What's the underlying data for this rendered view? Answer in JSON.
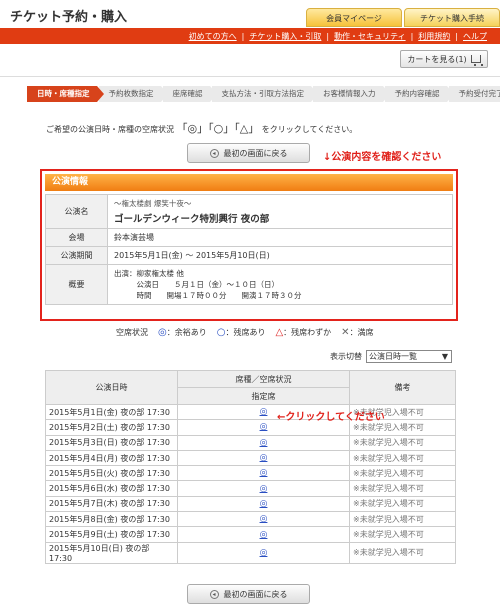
{
  "header": {
    "site_title": "チケット予約・購入",
    "tab_mypage": "会員マイページ",
    "tab_purchase": "チケット購入手続"
  },
  "nav": {
    "items": [
      "初めての方へ",
      "チケット購入・引取",
      "動作・セキュリティ",
      "利用規約",
      "ヘルプ"
    ]
  },
  "cart": {
    "label": "カートを見る(1)"
  },
  "steps": [
    "日時・席種指定",
    "予約枚数指定",
    "座席確認",
    "支払方法・引取方法指定",
    "お客様情報入力",
    "予約内容確認",
    "予約受付完了"
  ],
  "instruction": {
    "prefix": "ご希望の公演日時・席種の空席状況",
    "b1": "「",
    "s1": "◎",
    "b2": "」「",
    "s2": "○",
    "b3": "」「",
    "s3": "△",
    "b4": "」",
    "suffix": "をクリックしてください。"
  },
  "back_button": {
    "label": "最初の画面に戻る"
  },
  "red_note": "↓公演内容を確認ください",
  "performance": {
    "header": "公演情報",
    "labels": {
      "name": "公演名",
      "venue": "会場",
      "period": "公演期間",
      "overview": "概要"
    },
    "subtitle": "～権太楼劇 爆笑十夜～",
    "name": "ゴールデンウィーク特別興行 夜の部",
    "venue": "鈴本演芸場",
    "period": "2015年5月1日(金) ～ 2015年5月10日(日)",
    "overview": [
      "出演：柳家権太楼 他",
      "　　　公演日　　５月１日（金）～１０日（日）",
      "　　　時間　　開場１７時００分　　開演１７時３０分"
    ]
  },
  "legend": {
    "label": "空席状況",
    "items": [
      {
        "symbol": "◎",
        "text": "：余裕あり"
      },
      {
        "symbol": "○",
        "text": "：残席あり"
      },
      {
        "symbol": "△",
        "text": "：残席わずか"
      },
      {
        "symbol": "✕",
        "text": "：満席"
      }
    ]
  },
  "display_switch": {
    "label": "表示切替",
    "value": "公演日時一覧",
    "arrow": "▼"
  },
  "table": {
    "col_datetime": "公演日時",
    "col_status": "席種／空席状況",
    "col_seat": "指定席",
    "col_note": "備考",
    "rows": [
      {
        "date": "2015年5月1日(金) 夜の部 17:30",
        "status": "◎",
        "note": "※未就学児入場不可"
      },
      {
        "date": "2015年5月2日(土) 夜の部 17:30",
        "status": "◎",
        "note": "※未就学児入場不可"
      },
      {
        "date": "2015年5月3日(日) 夜の部 17:30",
        "status": "◎",
        "note": "※未就学児入場不可"
      },
      {
        "date": "2015年5月4日(月) 夜の部 17:30",
        "status": "◎",
        "note": "※未就学児入場不可"
      },
      {
        "date": "2015年5月5日(火) 夜の部 17:30",
        "status": "◎",
        "note": "※未就学児入場不可"
      },
      {
        "date": "2015年5月6日(水) 夜の部 17:30",
        "status": "◎",
        "note": "※未就学児入場不可"
      },
      {
        "date": "2015年5月7日(木) 夜の部 17:30",
        "status": "◎",
        "note": "※未就学児入場不可"
      },
      {
        "date": "2015年5月8日(金) 夜の部 17:30",
        "status": "◎",
        "note": "※未就学児入場不可"
      },
      {
        "date": "2015年5月9日(土) 夜の部 17:30",
        "status": "◎",
        "note": "※未就学児入場不可"
      },
      {
        "date": "2015年5月10日(日) 夜の部 17:30",
        "status": "◎",
        "note": "※未就学児入場不可"
      }
    ]
  },
  "click_note": "←クリックしてください"
}
